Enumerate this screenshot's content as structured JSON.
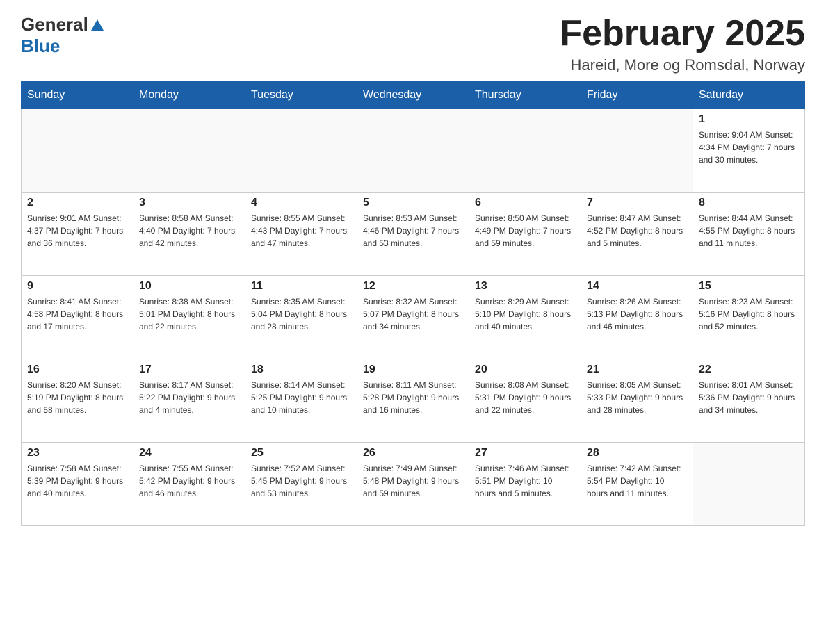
{
  "header": {
    "logo_general": "General",
    "logo_blue": "Blue",
    "month_title": "February 2025",
    "location": "Hareid, More og Romsdal, Norway"
  },
  "days_of_week": [
    "Sunday",
    "Monday",
    "Tuesday",
    "Wednesday",
    "Thursday",
    "Friday",
    "Saturday"
  ],
  "weeks": [
    [
      {
        "day": "",
        "info": ""
      },
      {
        "day": "",
        "info": ""
      },
      {
        "day": "",
        "info": ""
      },
      {
        "day": "",
        "info": ""
      },
      {
        "day": "",
        "info": ""
      },
      {
        "day": "",
        "info": ""
      },
      {
        "day": "1",
        "info": "Sunrise: 9:04 AM\nSunset: 4:34 PM\nDaylight: 7 hours\nand 30 minutes."
      }
    ],
    [
      {
        "day": "2",
        "info": "Sunrise: 9:01 AM\nSunset: 4:37 PM\nDaylight: 7 hours\nand 36 minutes."
      },
      {
        "day": "3",
        "info": "Sunrise: 8:58 AM\nSunset: 4:40 PM\nDaylight: 7 hours\nand 42 minutes."
      },
      {
        "day": "4",
        "info": "Sunrise: 8:55 AM\nSunset: 4:43 PM\nDaylight: 7 hours\nand 47 minutes."
      },
      {
        "day": "5",
        "info": "Sunrise: 8:53 AM\nSunset: 4:46 PM\nDaylight: 7 hours\nand 53 minutes."
      },
      {
        "day": "6",
        "info": "Sunrise: 8:50 AM\nSunset: 4:49 PM\nDaylight: 7 hours\nand 59 minutes."
      },
      {
        "day": "7",
        "info": "Sunrise: 8:47 AM\nSunset: 4:52 PM\nDaylight: 8 hours\nand 5 minutes."
      },
      {
        "day": "8",
        "info": "Sunrise: 8:44 AM\nSunset: 4:55 PM\nDaylight: 8 hours\nand 11 minutes."
      }
    ],
    [
      {
        "day": "9",
        "info": "Sunrise: 8:41 AM\nSunset: 4:58 PM\nDaylight: 8 hours\nand 17 minutes."
      },
      {
        "day": "10",
        "info": "Sunrise: 8:38 AM\nSunset: 5:01 PM\nDaylight: 8 hours\nand 22 minutes."
      },
      {
        "day": "11",
        "info": "Sunrise: 8:35 AM\nSunset: 5:04 PM\nDaylight: 8 hours\nand 28 minutes."
      },
      {
        "day": "12",
        "info": "Sunrise: 8:32 AM\nSunset: 5:07 PM\nDaylight: 8 hours\nand 34 minutes."
      },
      {
        "day": "13",
        "info": "Sunrise: 8:29 AM\nSunset: 5:10 PM\nDaylight: 8 hours\nand 40 minutes."
      },
      {
        "day": "14",
        "info": "Sunrise: 8:26 AM\nSunset: 5:13 PM\nDaylight: 8 hours\nand 46 minutes."
      },
      {
        "day": "15",
        "info": "Sunrise: 8:23 AM\nSunset: 5:16 PM\nDaylight: 8 hours\nand 52 minutes."
      }
    ],
    [
      {
        "day": "16",
        "info": "Sunrise: 8:20 AM\nSunset: 5:19 PM\nDaylight: 8 hours\nand 58 minutes."
      },
      {
        "day": "17",
        "info": "Sunrise: 8:17 AM\nSunset: 5:22 PM\nDaylight: 9 hours\nand 4 minutes."
      },
      {
        "day": "18",
        "info": "Sunrise: 8:14 AM\nSunset: 5:25 PM\nDaylight: 9 hours\nand 10 minutes."
      },
      {
        "day": "19",
        "info": "Sunrise: 8:11 AM\nSunset: 5:28 PM\nDaylight: 9 hours\nand 16 minutes."
      },
      {
        "day": "20",
        "info": "Sunrise: 8:08 AM\nSunset: 5:31 PM\nDaylight: 9 hours\nand 22 minutes."
      },
      {
        "day": "21",
        "info": "Sunrise: 8:05 AM\nSunset: 5:33 PM\nDaylight: 9 hours\nand 28 minutes."
      },
      {
        "day": "22",
        "info": "Sunrise: 8:01 AM\nSunset: 5:36 PM\nDaylight: 9 hours\nand 34 minutes."
      }
    ],
    [
      {
        "day": "23",
        "info": "Sunrise: 7:58 AM\nSunset: 5:39 PM\nDaylight: 9 hours\nand 40 minutes."
      },
      {
        "day": "24",
        "info": "Sunrise: 7:55 AM\nSunset: 5:42 PM\nDaylight: 9 hours\nand 46 minutes."
      },
      {
        "day": "25",
        "info": "Sunrise: 7:52 AM\nSunset: 5:45 PM\nDaylight: 9 hours\nand 53 minutes."
      },
      {
        "day": "26",
        "info": "Sunrise: 7:49 AM\nSunset: 5:48 PM\nDaylight: 9 hours\nand 59 minutes."
      },
      {
        "day": "27",
        "info": "Sunrise: 7:46 AM\nSunset: 5:51 PM\nDaylight: 10 hours\nand 5 minutes."
      },
      {
        "day": "28",
        "info": "Sunrise: 7:42 AM\nSunset: 5:54 PM\nDaylight: 10 hours\nand 11 minutes."
      },
      {
        "day": "",
        "info": ""
      }
    ]
  ]
}
